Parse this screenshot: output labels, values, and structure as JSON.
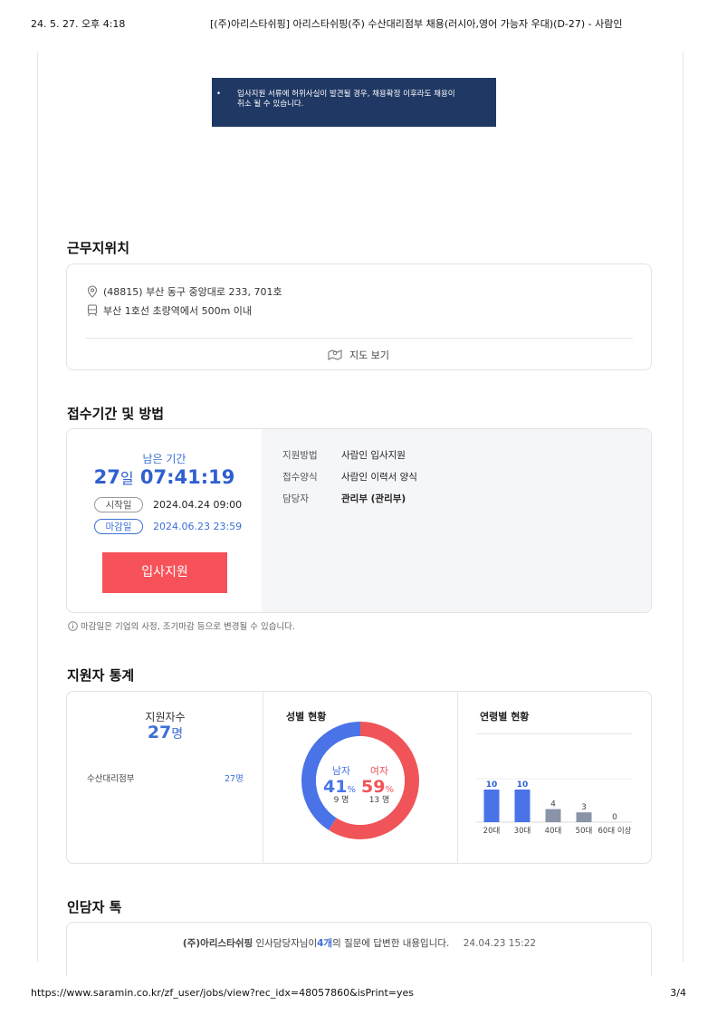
{
  "print_header": {
    "datetime": "24. 5. 27. 오후 4:18",
    "title": "[(주)아리스타쉬핑] 아리스타쉬핑(주) 수산대리점부 채용(러시아,영어 가능자 우대)(D-27) - 사람인"
  },
  "notice": {
    "bullet": "•",
    "line1": "입사지원 서류에 허위사실이 발견될 경우, 채용확정 이후라도 채용이",
    "line2": "취소 될 수 있습니다."
  },
  "location": {
    "heading": "근무지위치",
    "address": "(48815) 부산 동구 중앙대로 233, 701호",
    "subway": "부산 1호선 초량역에서 500m 이내",
    "map_button": "지도 보기"
  },
  "application": {
    "heading": "접수기간 및 방법",
    "remaining_label": "남은 기간",
    "remaining_days": "27",
    "remaining_days_unit": "일",
    "remaining_time": "07:41:19",
    "start_label": "시작일",
    "start_value": "2024.04.24 09:00",
    "end_label": "마감일",
    "end_value": "2024.06.23 23:59",
    "apply_button": "입사지원",
    "method_label": "지원방법",
    "method_value": "사람인 입사지원",
    "form_label": "접수양식",
    "form_value": "사람인 이력서 양식",
    "contact_label": "담당자",
    "contact_value": "관리부 (관리부)",
    "note": "마감일은 기업의 사정, 조기마감 등으로 변경될 수 있습니다."
  },
  "stats": {
    "heading": "지원자 통계",
    "applicants_label": "지원자수",
    "applicants_value": "27",
    "applicants_unit": "명",
    "dept_name": "수산대리점부",
    "dept_value": "27명",
    "gender_title": "성별 현황",
    "age_title": "연령별 현황",
    "colors": {
      "male": "#4a73e8",
      "female": "#f05459",
      "age_high": "#4a73e8",
      "age_low": "#8a94a8"
    }
  },
  "chart_data": [
    {
      "type": "pie",
      "title": "성별 현황",
      "slices": [
        {
          "name": "남자",
          "percent": 41,
          "count_label": "9 명"
        },
        {
          "name": "여자",
          "percent": 59,
          "count_label": "13 명"
        }
      ],
      "percent_unit": "%"
    },
    {
      "type": "bar",
      "title": "연령별 현황",
      "categories": [
        "20대",
        "30대",
        "40대",
        "50대",
        "60대 이상"
      ],
      "values": [
        10,
        10,
        4,
        3,
        0
      ]
    }
  ],
  "talk": {
    "heading": "인담자 톡",
    "company": "(주)아리스타쉬핑",
    "text1": "인사담당자님이",
    "count": "4개",
    "text2": "의 질문에 답변한 내용입니다.",
    "date": "24.04.23 15:22"
  },
  "print_footer": {
    "url": "https://www.saramin.co.kr/zf_user/jobs/view?rec_idx=48057860&isPrint=yes",
    "page": "3/4"
  }
}
